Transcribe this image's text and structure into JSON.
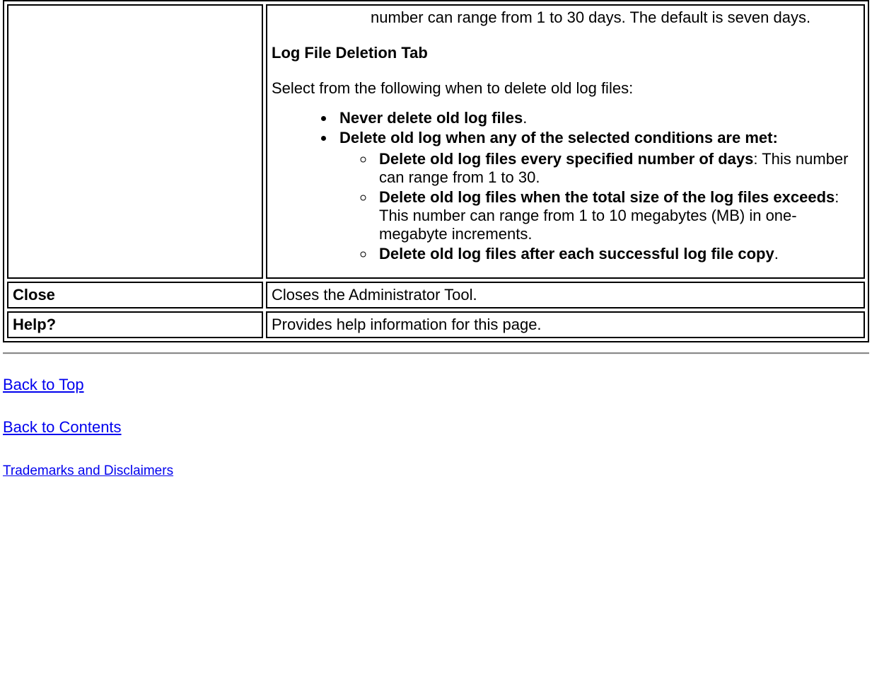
{
  "table": {
    "row_main": {
      "fragment": "number can range from 1 to 30 days. The default is seven days.",
      "heading": "Log File Deletion Tab",
      "intro": "Select from the following when to delete old log files:",
      "item1": "Never delete old log files",
      "item2": "Delete old log when any of the selected conditions are met:",
      "sub1_bold": "Delete old log files every specified number of days",
      "sub1_rest": ": This number can range from 1 to 30.",
      "sub2_bold": "Delete old log files when the total size of the log files exceeds",
      "sub2_rest": ": This number can range from 1 to 10 megabytes (MB) in one-megabyte increments.",
      "sub3_bold": "Delete old log files after each successful log file copy",
      "sub3_rest": "."
    },
    "row_close": {
      "label": "Close",
      "desc": "Closes the Administrator Tool."
    },
    "row_help": {
      "label": "Help?",
      "desc": "Provides help information for this page."
    }
  },
  "links": {
    "back_to_top": "Back to Top",
    "back_to_contents": "Back to Contents",
    "trademarks": "Trademarks and Disclaimers"
  }
}
